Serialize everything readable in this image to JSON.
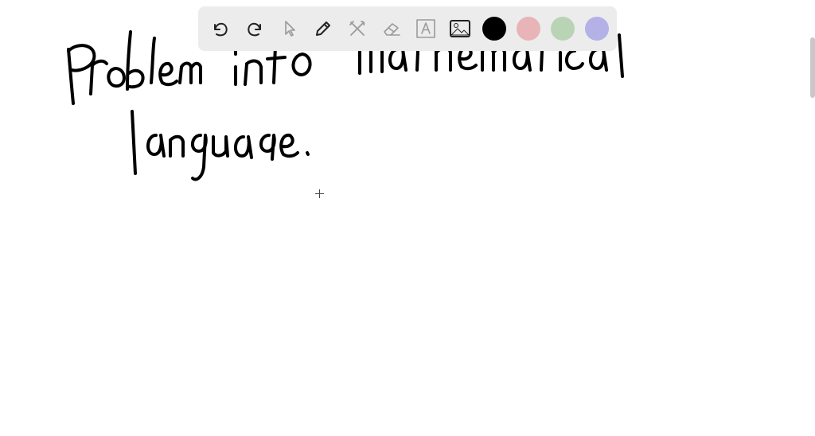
{
  "toolbar": {
    "tools": [
      {
        "name": "undo",
        "icon": "undo-icon",
        "enabled": true
      },
      {
        "name": "redo",
        "icon": "redo-icon",
        "enabled": true
      },
      {
        "name": "select",
        "icon": "pointer-icon",
        "enabled": false
      },
      {
        "name": "pen",
        "icon": "pencil-icon",
        "enabled": true
      },
      {
        "name": "tools",
        "icon": "tools-icon",
        "enabled": false
      },
      {
        "name": "eraser",
        "icon": "eraser-icon",
        "enabled": false
      },
      {
        "name": "text",
        "icon": "text-box-icon",
        "enabled": false
      },
      {
        "name": "image",
        "icon": "image-icon",
        "enabled": true
      }
    ],
    "colors": [
      "#000000",
      "#e8b4b8",
      "#b9d4b5",
      "#b3b1e6"
    ],
    "selected_color": "#000000"
  }
}
